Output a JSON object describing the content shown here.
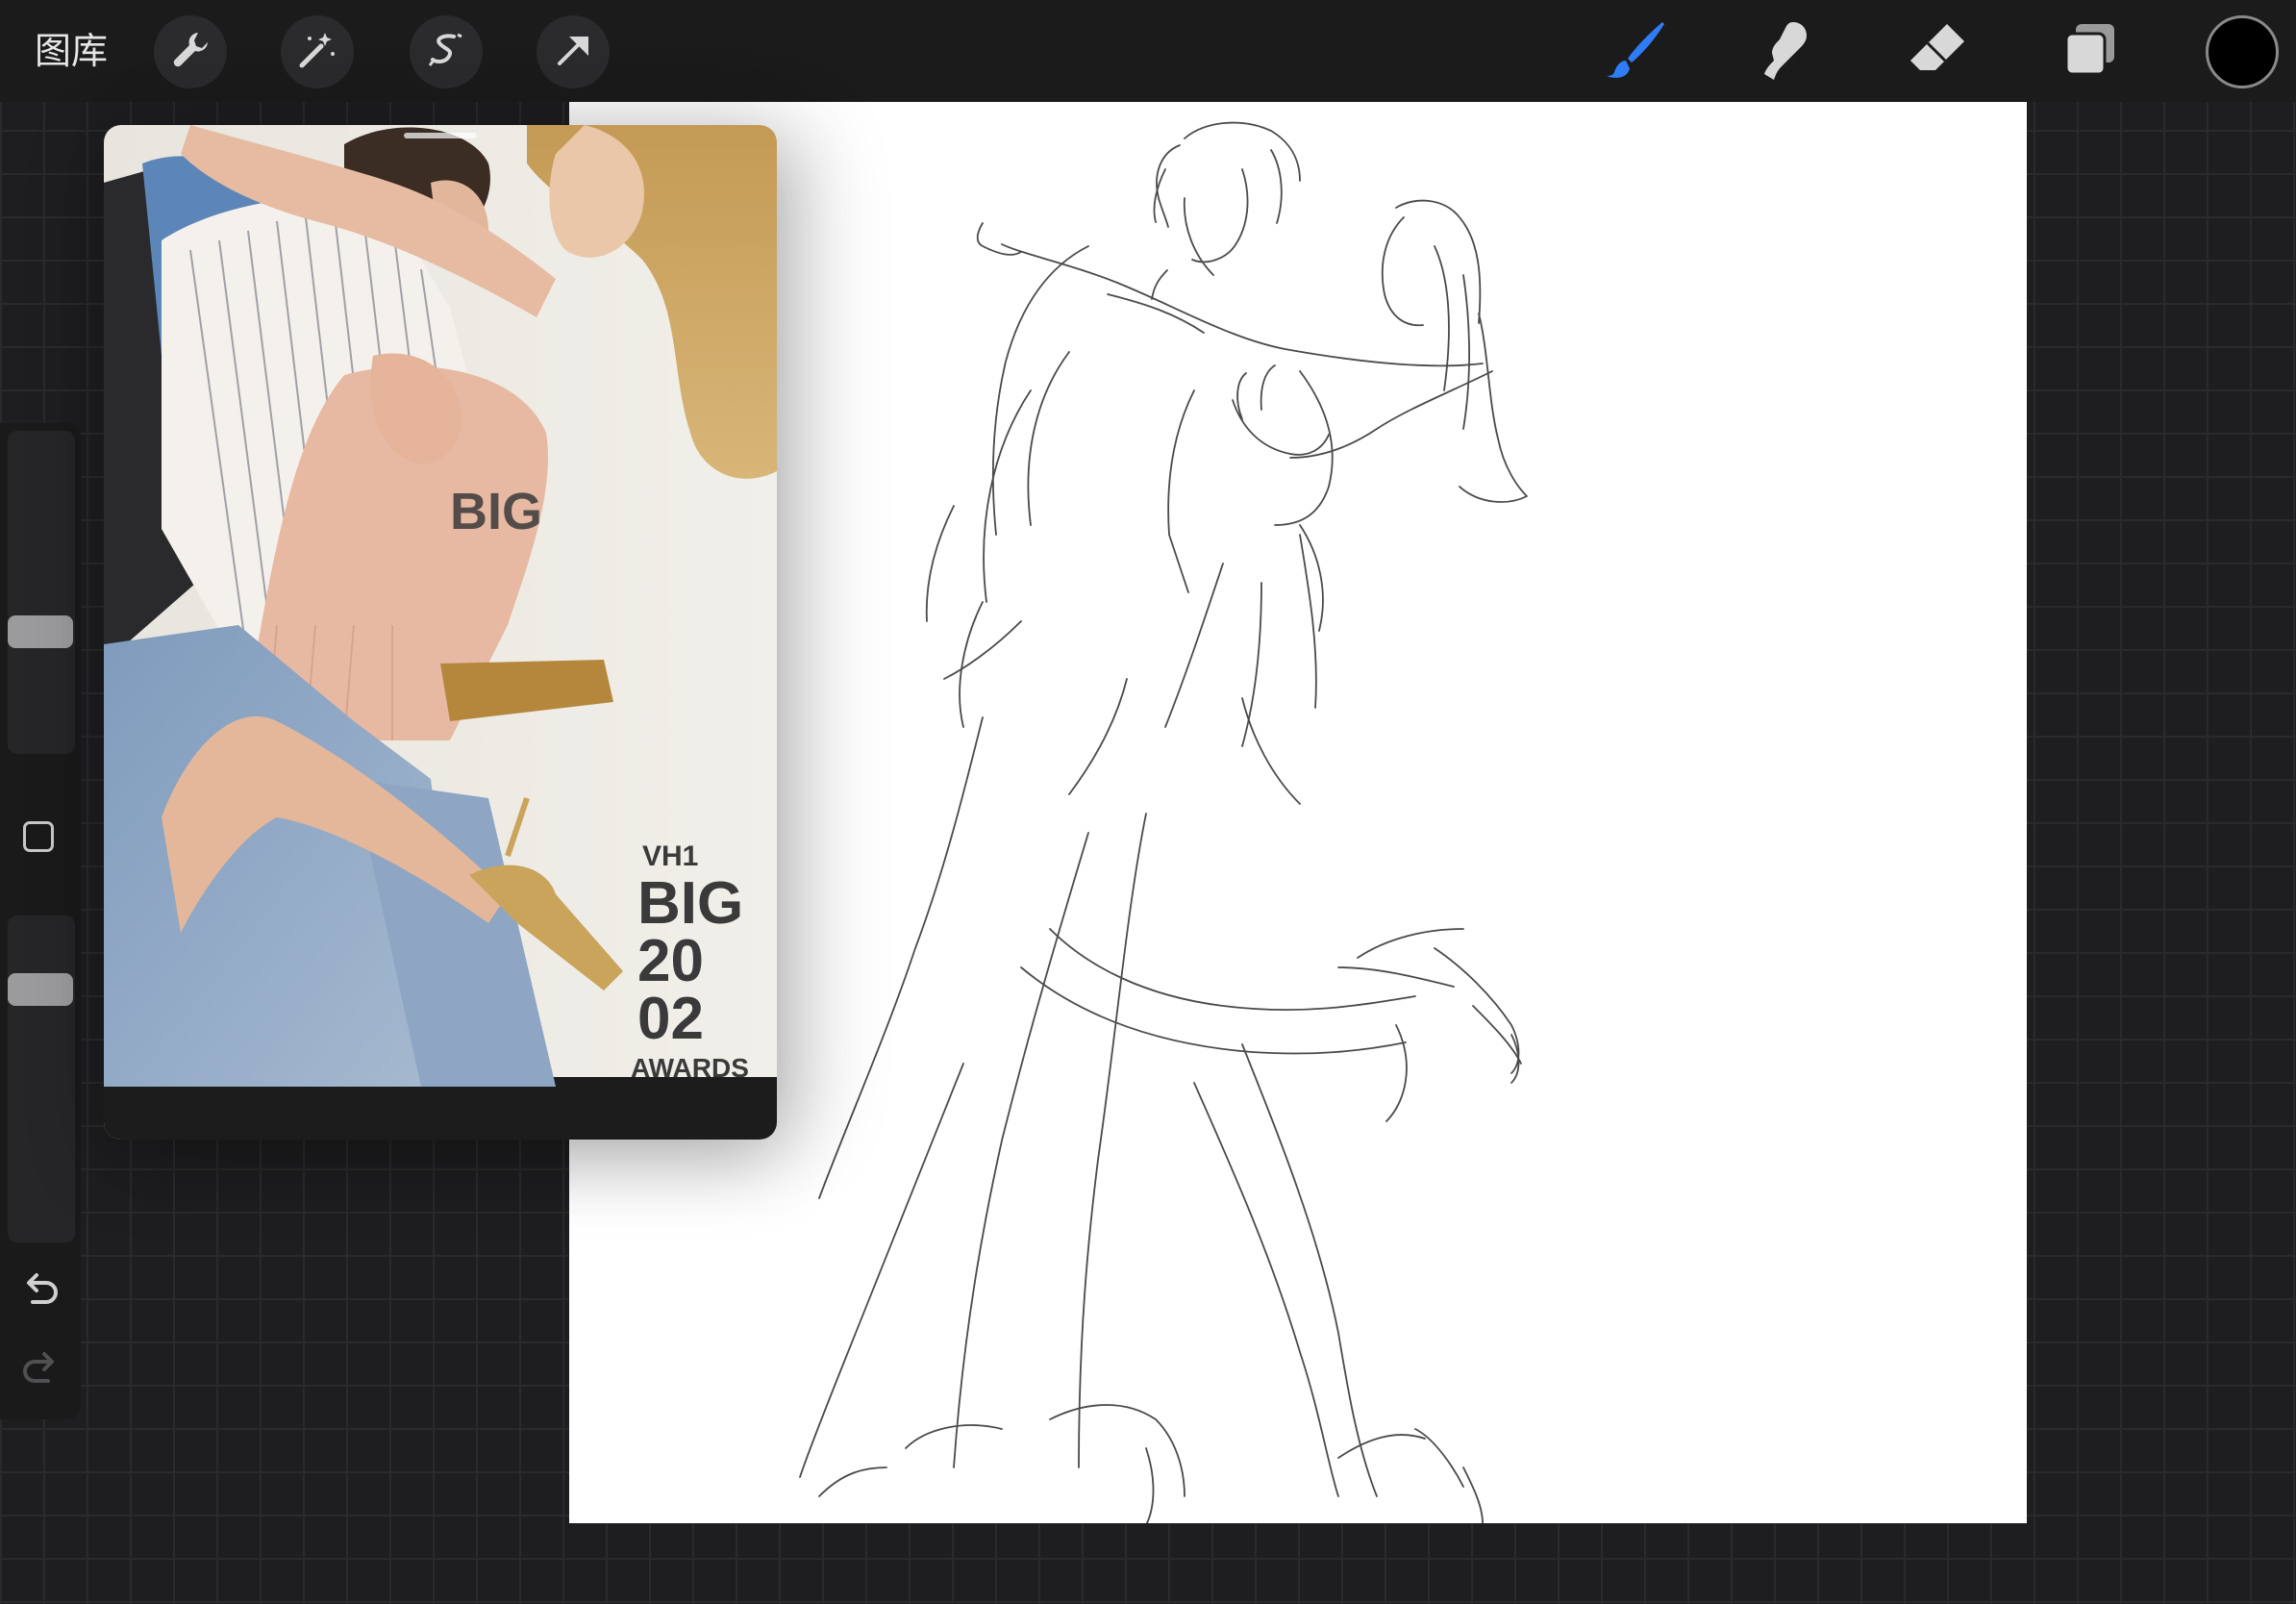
{
  "topbar": {
    "gallery_label": "图库",
    "left_tools": [
      {
        "name": "actions",
        "icon": "wrench-icon"
      },
      {
        "name": "adjustments",
        "icon": "magic-wand-icon"
      },
      {
        "name": "selection",
        "icon": "selection-s-icon"
      },
      {
        "name": "transform",
        "icon": "arrow-cursor-icon"
      }
    ],
    "right_tools": [
      {
        "name": "brush",
        "icon": "brush-icon",
        "active": true
      },
      {
        "name": "smudge",
        "icon": "smudge-finger-icon",
        "active": false
      },
      {
        "name": "eraser",
        "icon": "eraser-icon",
        "active": false
      },
      {
        "name": "layers",
        "icon": "layers-icon",
        "active": false
      }
    ],
    "current_color": "#000000"
  },
  "sidebar": {
    "brush_size_slider": "slider",
    "modify_button_icon": "square-icon",
    "opacity_slider": "slider",
    "undo_icon": "undo-arrow-icon",
    "redo_icon": "redo-arrow-icon"
  },
  "reference": {
    "sign_lines": [
      "VH1",
      "BIG",
      "20",
      "02",
      "AWARDS"
    ]
  },
  "colors": {
    "accent": "#2f7cf6",
    "toolbar_bg": "#1b1b1c",
    "canvas_bg": "#ffffff",
    "workspace_bg": "#1e1e20"
  }
}
